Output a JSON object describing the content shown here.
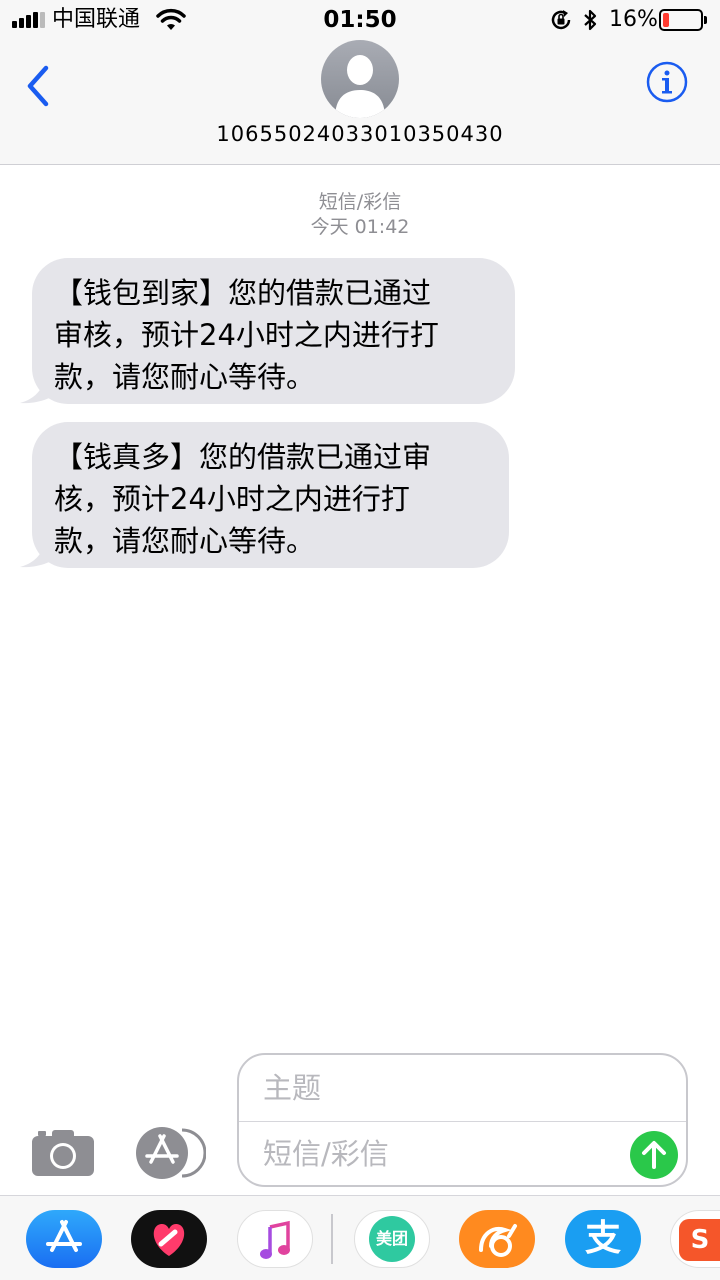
{
  "status_bar": {
    "carrier": "中国联通",
    "time": "01:50",
    "battery_text": "16%",
    "battery_level": 0.16,
    "icons": [
      "signal-icon",
      "wifi-icon",
      "rotation-lock-icon",
      "bluetooth-icon",
      "battery-icon"
    ]
  },
  "header": {
    "contact_number": "10655024033010350430",
    "icons": [
      "back-chevron-icon",
      "contact-avatar-icon",
      "info-icon"
    ]
  },
  "conversation": {
    "message_type": "短信/彩信",
    "timestamp": "今天 01:42",
    "messages": [
      {
        "line1": "【钱包到家】您的借款已通过",
        "line2": "审核，预计24小时之内进行打",
        "line3": "款，请您耐心等待。"
      },
      {
        "line1": "【钱真多】您的借款已通过审",
        "line2": "核，预计24小时之内进行打",
        "line3": "款，请您耐心等待。"
      }
    ]
  },
  "compose": {
    "subject_placeholder": "主题",
    "message_placeholder": "短信/彩信",
    "subject_value": "",
    "message_value": "",
    "icons": [
      "camera-icon",
      "app-store-icon",
      "send-arrow-icon"
    ]
  },
  "app_drawer": {
    "apps": [
      {
        "name": "app-store",
        "label": ""
      },
      {
        "name": "digital-touch",
        "label": ""
      },
      {
        "name": "music",
        "label": ""
      },
      {
        "name": "meituan",
        "label": "美团"
      },
      {
        "name": "uc-browser",
        "label": ""
      },
      {
        "name": "alipay",
        "label": "支"
      },
      {
        "name": "sogou",
        "label": "S"
      }
    ]
  },
  "colors": {
    "ios_blue": "#1a5cf0",
    "bubble_gray": "#e5e5ea",
    "send_green": "#2ac84a",
    "battery_red": "#ff3b30"
  }
}
